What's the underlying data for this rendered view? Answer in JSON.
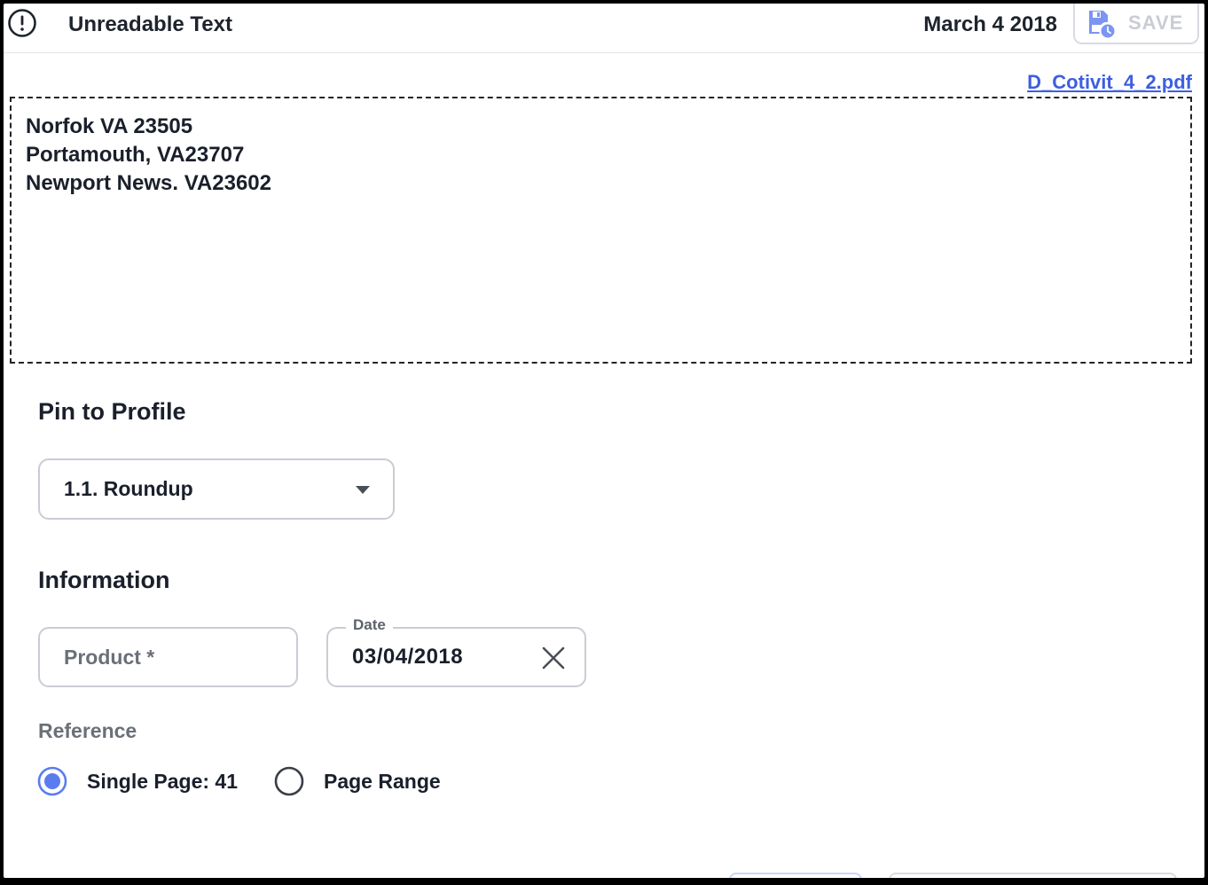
{
  "header": {
    "title": "Unreadable Text",
    "date": "March 4 2018",
    "save_label": "SAVE",
    "alert_icon": "alert-circle-icon",
    "save_icon": "save-schedule-icon"
  },
  "document": {
    "file_name": "D_Cotivit_4_2.pdf",
    "lines": [
      "Norfok VA 23505",
      "Portamouth, VA23707",
      "Newport News. VA23602"
    ]
  },
  "pin_section": {
    "title": "Pin to Profile",
    "selected_profile": "1.1. Roundup"
  },
  "information": {
    "title": "Information",
    "product_placeholder": "Product *",
    "date_label": "Date",
    "date_value": "03/04/2018"
  },
  "reference": {
    "label": "Reference",
    "options": [
      {
        "label": "Single Page: 41",
        "selected": true
      },
      {
        "label": "Page Range",
        "selected": false
      }
    ]
  },
  "colors": {
    "accent": "#3e5ee0",
    "radio_selected": "#5b7cf0",
    "border": "#c9ccd4"
  }
}
